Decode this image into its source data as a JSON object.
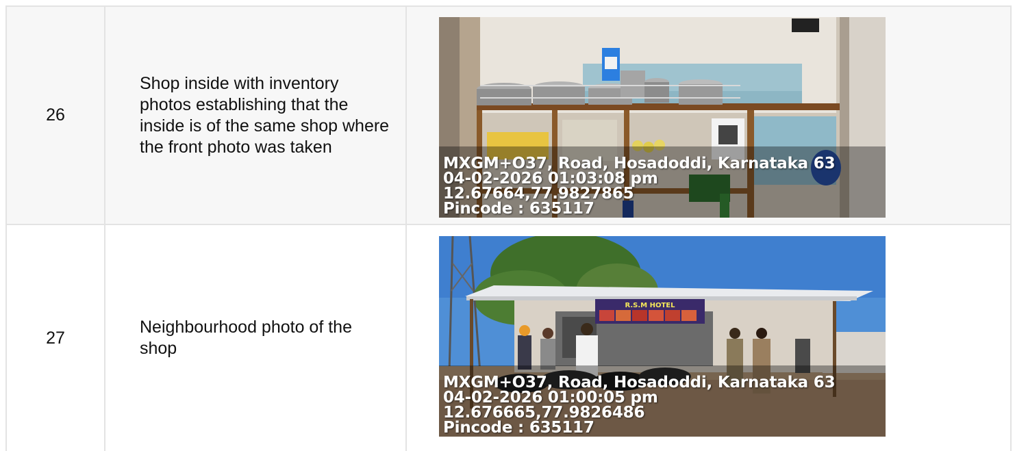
{
  "rows": [
    {
      "number": "26",
      "description": "Shop inside with inventory photos establishing that the inside is of the same shop where the front photo was taken",
      "photo": {
        "subject": "shop interior with inventory shelves",
        "stamp": {
          "address": "MXGM+O37, Road, Hosadoddi, Karnataka 63",
          "datetime": "04-02-2026 01:03:08 pm",
          "coordinates": "12.67664,77.9827865",
          "pincode": "Pincode : 635117"
        }
      }
    },
    {
      "number": "27",
      "description": "Neighbourhood photo of the shop",
      "photo": {
        "subject": "shop exterior with sign and parked motorbikes",
        "sign_text": "R.S.M HOTEL",
        "stamp": {
          "address": "MXGM+O37, Road, Hosadoddi, Karnataka 63",
          "datetime": "04-02-2026 01:00:05 pm",
          "coordinates": "12.676665,77.9826486",
          "pincode": "Pincode : 635117"
        }
      }
    }
  ]
}
